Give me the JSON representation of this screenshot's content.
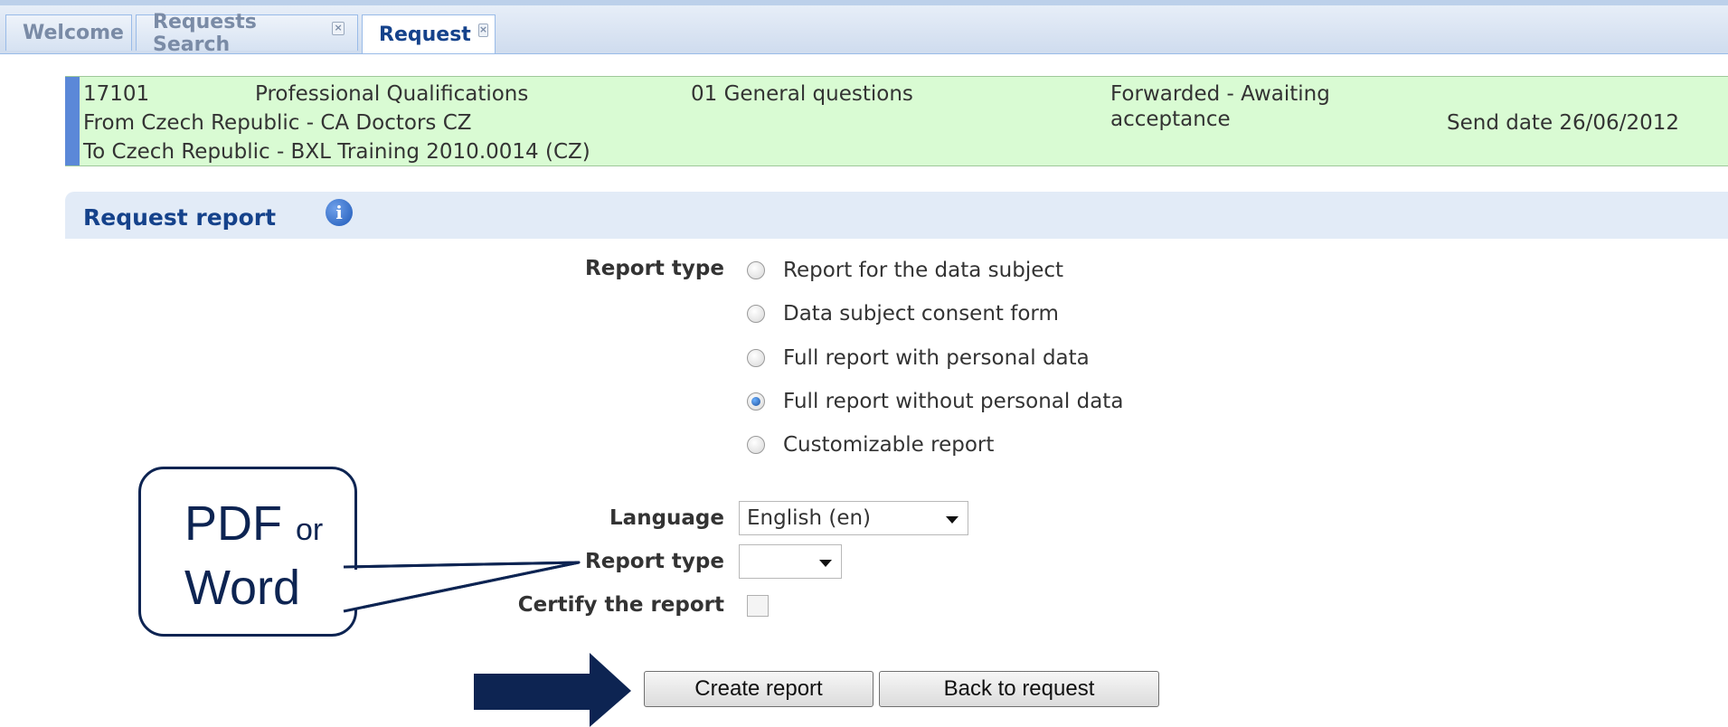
{
  "tabs": [
    {
      "label": "Welcome",
      "closable": false,
      "active": false
    },
    {
      "label": "Requests Search",
      "closable": true,
      "active": false
    },
    {
      "label": "Request",
      "closable": true,
      "active": true
    }
  ],
  "request_info": {
    "id": "17101",
    "area": "Professional Qualifications",
    "question_set": "01 General questions",
    "status_line1": "Forwarded - Awaiting",
    "status_line2": "acceptance",
    "from": "From Czech Republic - CA Doctors CZ",
    "to": "To Czech Republic - BXL Training 2010.0014 (CZ)",
    "send_date": "Send date 26/06/2012"
  },
  "section": {
    "title": "Request report",
    "info_icon": "info-icon"
  },
  "form": {
    "report_type_label": "Report type",
    "report_type_options": [
      {
        "label": "Report for the data subject",
        "checked": false
      },
      {
        "label": "Data subject consent form",
        "checked": false
      },
      {
        "label": "Full report with personal data",
        "checked": false
      },
      {
        "label": "Full report without personal data",
        "checked": true
      },
      {
        "label": "Customizable report",
        "checked": false
      }
    ],
    "language_label": "Language",
    "language_value": "English (en)",
    "format_label": "Report type",
    "format_value": "",
    "certify_label": "Certify the report",
    "certify_checked": false
  },
  "buttons": {
    "create": "Create report",
    "back": "Back to request"
  },
  "annotation": {
    "callout_word1": "PDF",
    "callout_or": "or",
    "callout_word2": "Word",
    "color": "#0d2452"
  },
  "colors": {
    "info_bg": "#d9fbd3",
    "info_bar": "#5b88d8",
    "section_bg": "#e2ebf7",
    "section_title": "#15428b"
  }
}
